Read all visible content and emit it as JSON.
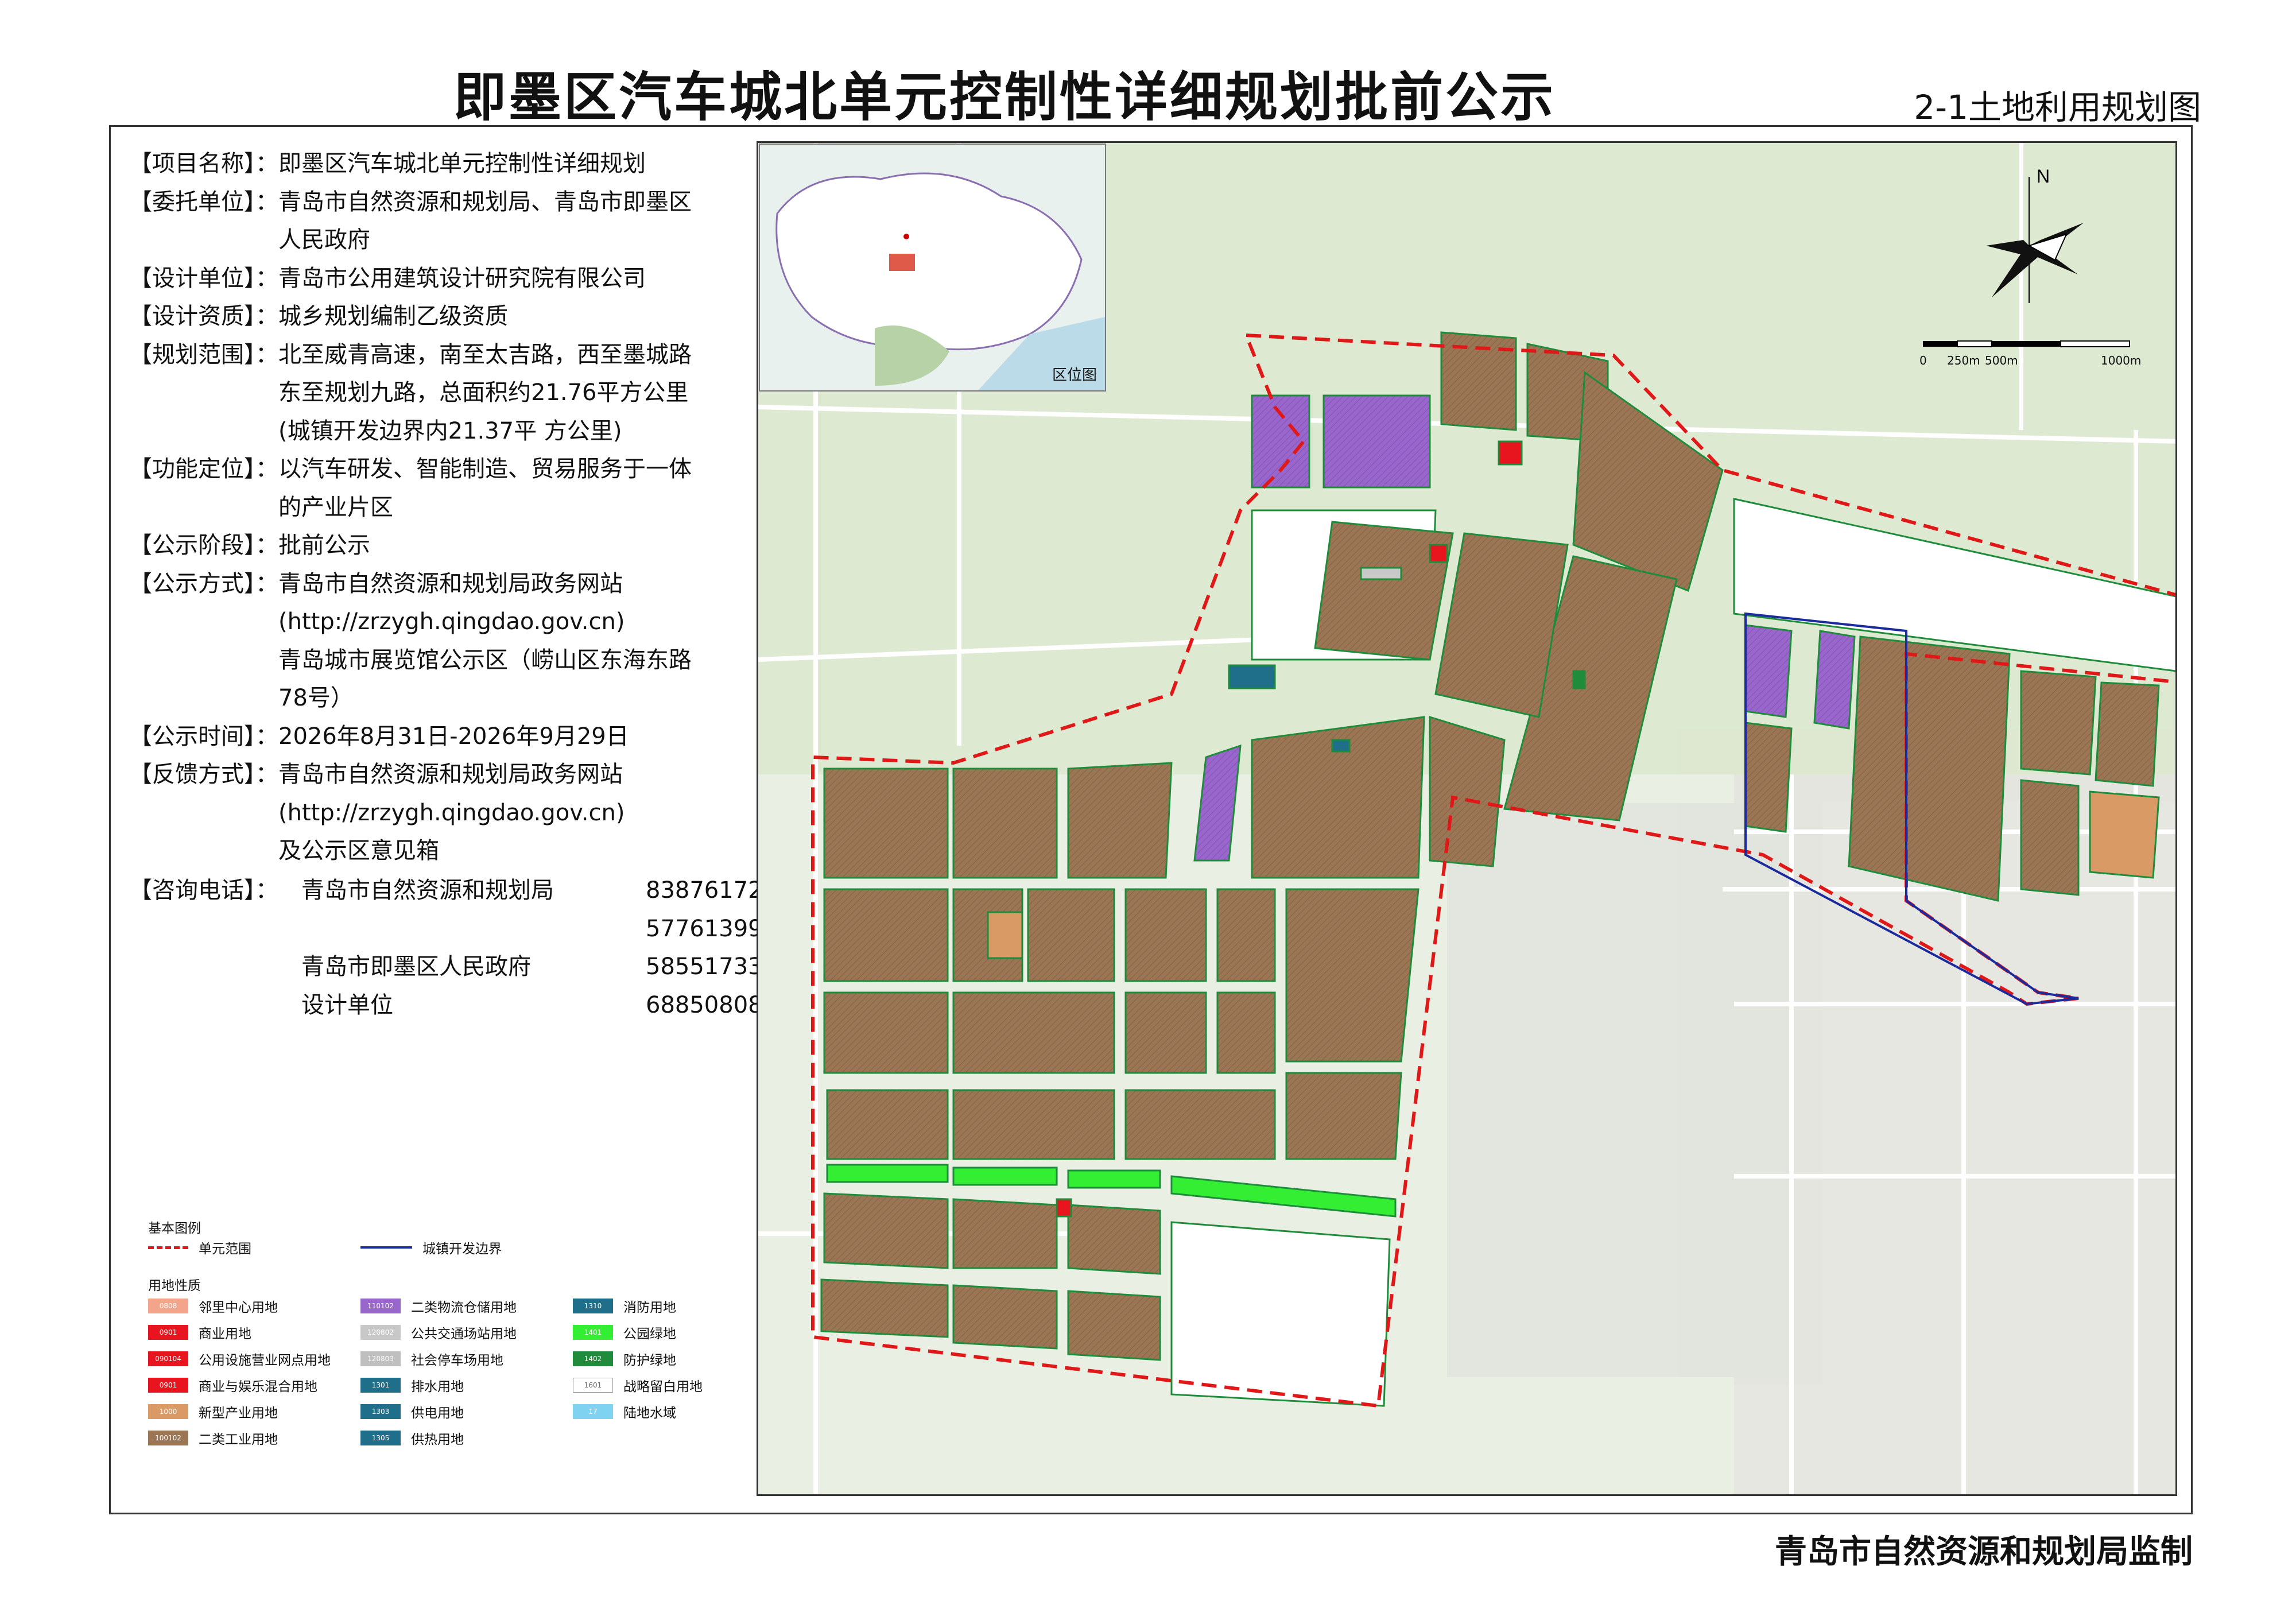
{
  "header": {
    "title": "即墨区汽车城北单元控制性详细规划批前公示",
    "subtitle": "2-1土地利用规划图"
  },
  "info": [
    {
      "label": "【项目名称】：",
      "lines": [
        "即墨区汽车城北单元控制性详细规划"
      ]
    },
    {
      "label": "【委托单位】：",
      "lines": [
        "青岛市自然资源和规划局、青岛市即墨区",
        "人民政府"
      ]
    },
    {
      "label": "【设计单位】：",
      "lines": [
        "青岛市公用建筑设计研究院有限公司"
      ]
    },
    {
      "label": "【设计资质】：",
      "lines": [
        "城乡规划编制乙级资质"
      ]
    },
    {
      "label": "【规划范围】：",
      "lines": [
        "北至威青高速，南至太吉路，西至墨城路",
        "东至规划九路，总面积约21.76平方公里",
        "(城镇开发边界内21.37平 方公里)"
      ]
    },
    {
      "label": "【功能定位】：",
      "lines": [
        "以汽车研发、智能制造、贸易服务于一体",
        "的产业片区"
      ]
    },
    {
      "label": "【公示阶段】：",
      "lines": [
        "批前公示"
      ]
    },
    {
      "label": "【公示方式】：",
      "lines": [
        "青岛市自然资源和规划局政务网站",
        "(http://zrzygh.qingdao.gov.cn)",
        "青岛城市展览馆公示区（崂山区东海东路",
        "78号）"
      ]
    },
    {
      "label": "【公示时间】：",
      "lines": [
        "2026年8月31日-2026年9月29日"
      ]
    },
    {
      "label": "【反馈方式】：",
      "lines": [
        "青岛市自然资源和规划局政务网站",
        "(http://zrzygh.qingdao.gov.cn)",
        "及公示区意见箱"
      ]
    }
  ],
  "consult": {
    "label": "【咨询电话】：",
    "rows": [
      {
        "name": "青岛市自然资源和规划局",
        "phone": "83876172"
      },
      {
        "name": "",
        "phone": "57761399"
      },
      {
        "name": "青岛市即墨区人民政府",
        "phone": "58551733"
      },
      {
        "name": "设计单位",
        "phone": "68850808"
      }
    ]
  },
  "legend": {
    "title": "基本图例",
    "boundary_unit": "单元范围",
    "boundary_dev": "城镇开发边界",
    "landuse_title": "用地性质",
    "items": [
      {
        "code": "0808",
        "label": "邻里中心用地",
        "color": "#f2a58a"
      },
      {
        "code": "0901",
        "label": "商业用地",
        "color": "#e8141e"
      },
      {
        "code": "090104",
        "label": "公用设施营业网点用地",
        "color": "#e8141e"
      },
      {
        "code": "0901",
        "label": "商业与娱乐混合用地",
        "color": "#e8141e"
      },
      {
        "code": "1000",
        "label": "新型产业用地",
        "color": "#d99a66"
      },
      {
        "code": "100102",
        "label": "二类工业用地",
        "color": "#9b7654"
      },
      {
        "code": "110102",
        "label": "二类物流仓储用地",
        "color": "#9966cc"
      },
      {
        "code": "120802",
        "label": "公共交通场站用地",
        "color": "#c8c8c8"
      },
      {
        "code": "120803",
        "label": "社会停车场用地",
        "color": "#bfbfbf"
      },
      {
        "code": "1301",
        "label": "排水用地",
        "color": "#1f6f8b"
      },
      {
        "code": "1303",
        "label": "供电用地",
        "color": "#1f6f8b"
      },
      {
        "code": "1305",
        "label": "供热用地",
        "color": "#1f6f8b"
      },
      {
        "code": "1310",
        "label": "消防用地",
        "color": "#1f6f8b"
      },
      {
        "code": "1401",
        "label": "公园绿地",
        "color": "#33ee33"
      },
      {
        "code": "1402",
        "label": "防护绿地",
        "color": "#1e8c3a"
      },
      {
        "code": "1601",
        "label": "战略留白用地",
        "color": "#ffffff"
      },
      {
        "code": "17",
        "label": "陆地水域",
        "color": "#7fd3f0"
      }
    ]
  },
  "map": {
    "inset_label": "区位图",
    "north_label": "N",
    "scale_labels": [
      "0",
      "250m",
      "500m",
      "1000m"
    ]
  },
  "footer": {
    "text": "青岛市自然资源和规划局监制"
  }
}
